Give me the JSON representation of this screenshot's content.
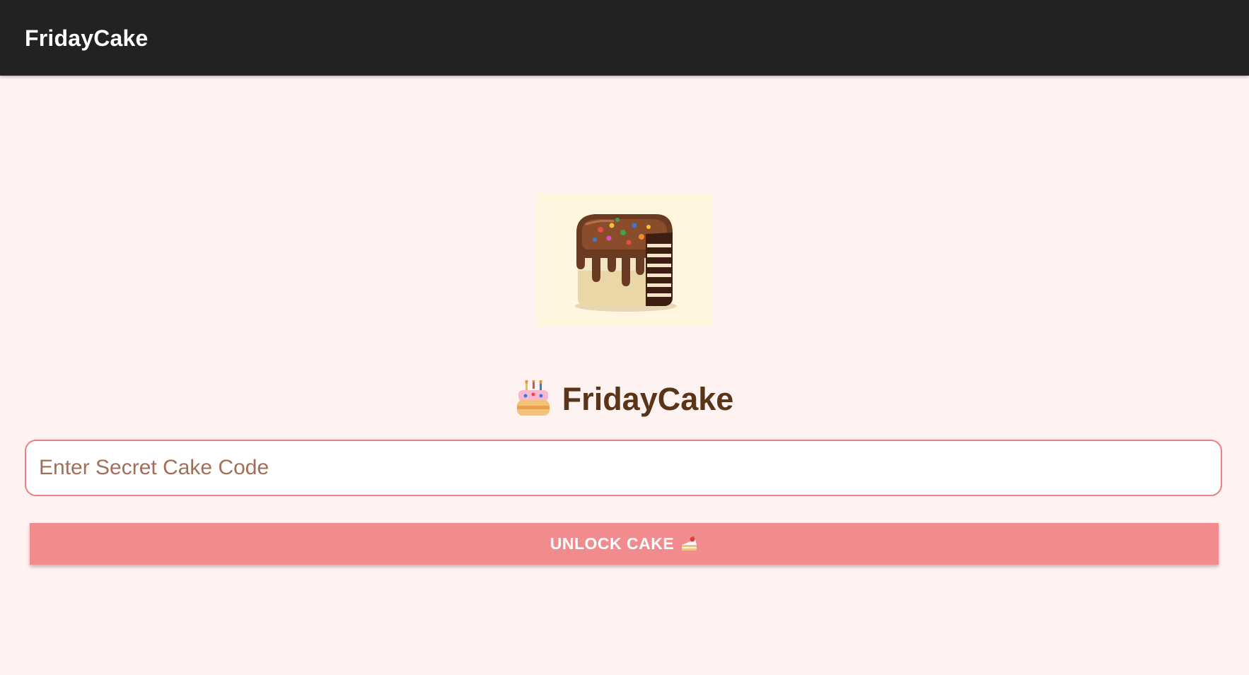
{
  "app_bar": {
    "title": "FridayCake",
    "background": "#222222"
  },
  "main": {
    "logo_icon": "chocolate-cake-illustration",
    "heading": {
      "emoji_icon": "birthday-cake-icon",
      "text": "FridayCake",
      "color": "#5a3418"
    },
    "code_input": {
      "placeholder": "Enter Secret Cake Code",
      "value": "",
      "border_color": "#ec7f86"
    },
    "unlock_button": {
      "label": "UNLOCK CAKE",
      "icon": "shortcake-icon",
      "background": "#f28b8d"
    }
  },
  "colors": {
    "page_background": "#fff3f2"
  }
}
